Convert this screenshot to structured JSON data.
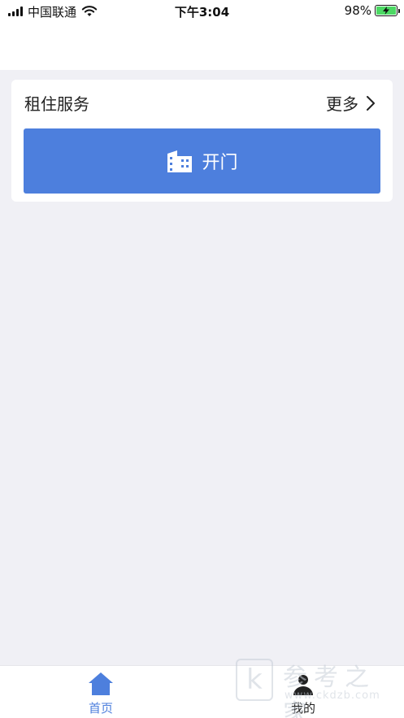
{
  "status_bar": {
    "carrier": "中国联通",
    "time": "下午3:04",
    "battery_percent_text": "98%",
    "battery_level": 0.98,
    "signal_icon": "signal-icon",
    "wifi_icon": "wifi-icon"
  },
  "rental_card": {
    "title": "租住服务",
    "more_label": "更多",
    "more_icon": "chevron-right-icon",
    "open_door_label": "开门",
    "open_door_icon": "building-icon"
  },
  "tab_bar": {
    "tabs": [
      {
        "label": "首页",
        "icon": "home-icon",
        "active": true
      },
      {
        "label": "我的",
        "icon": "user-icon",
        "active": false
      }
    ]
  },
  "watermark": {
    "logo_letter": "k",
    "title": "参考之家",
    "url": "www.ckdzb.com"
  },
  "colors": {
    "accent": "#4d7fdd",
    "background": "#f0f0f5",
    "card": "#ffffff",
    "battery_fill": "#4cd964"
  }
}
